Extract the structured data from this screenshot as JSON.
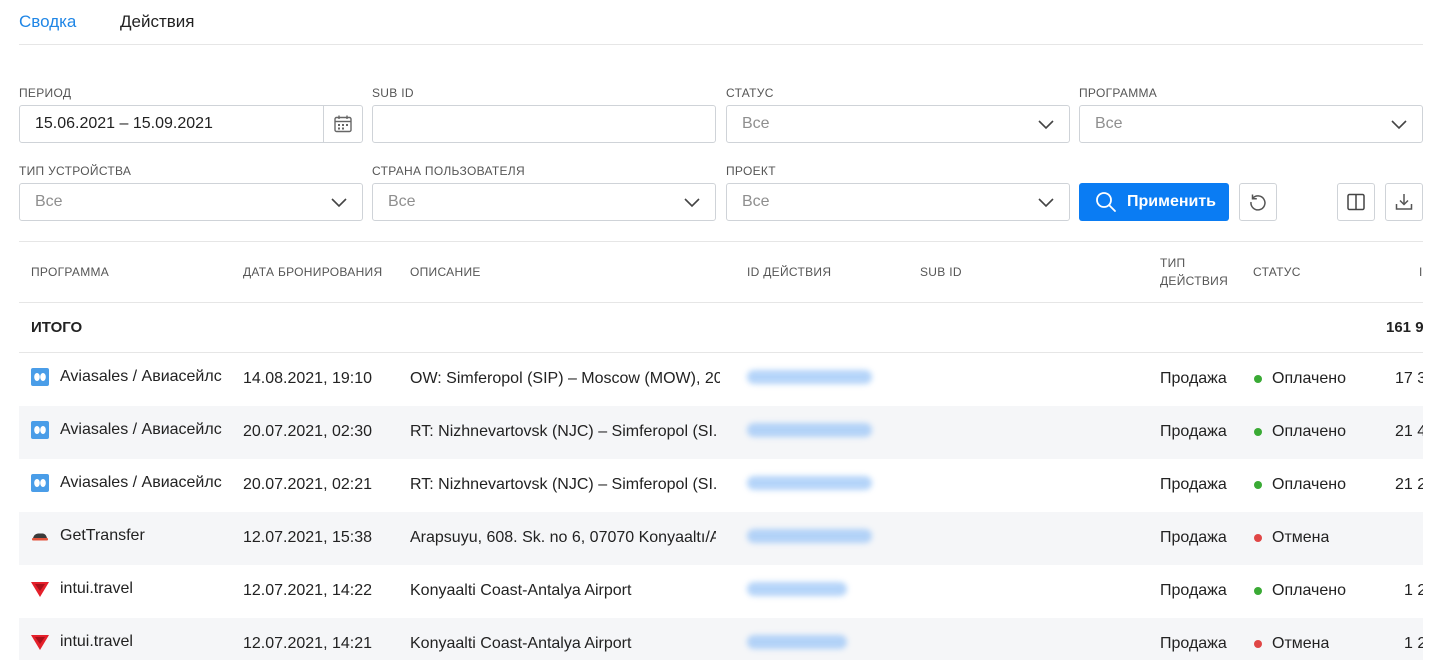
{
  "tabs": [
    {
      "label": "Сводка",
      "active": true
    },
    {
      "label": "Действия",
      "active": false
    }
  ],
  "filters": {
    "period": {
      "label": "ПЕРИОД",
      "value": "15.06.2021 – 15.09.2021"
    },
    "sub_id": {
      "label": "SUB ID",
      "value": ""
    },
    "status": {
      "label": "СТАТУС",
      "placeholder": "Все"
    },
    "program": {
      "label": "ПРОГРАММА",
      "placeholder": "Все"
    },
    "device_type": {
      "label": "ТИП УСТРОЙСТВА",
      "placeholder": "Все"
    },
    "user_country": {
      "label": "СТРАНА ПОЛЬЗОВАТЕЛЯ",
      "placeholder": "Все"
    },
    "project": {
      "label": "ПРОЕКТ",
      "placeholder": "Все"
    },
    "apply_label": "Применить"
  },
  "table": {
    "headers": {
      "program": "ПРОГРАММА",
      "booking_date": "ДАТА БРОНИРОВАНИЯ",
      "description": "ОПИСАНИЕ",
      "action_id": "ID ДЕЙСТВИЯ",
      "sub_id": "SUB ID",
      "action_type_1": "ТИП",
      "action_type_2": "ДЕЙСТВИЯ",
      "status": "СТАТУС",
      "last_partial": "I"
    },
    "total": {
      "label": "ИТОГО",
      "value": "161 9"
    },
    "rows": [
      {
        "icon": "aviasales-icon",
        "program": "Aviasales / Авиасейлс",
        "date": "14.08.2021, 19:10",
        "description": "OW: Simferopol (SIP) – Moscow (MOW), 20...",
        "type": "Продажа",
        "status": "Оплачено",
        "status_color": "#3aaa35",
        "amount": "17 3"
      },
      {
        "icon": "aviasales-icon",
        "program": "Aviasales / Авиасейлс",
        "date": "20.07.2021, 02:30",
        "description": "RT: Nizhnevartovsk (NJC) – Simferopol (SI...",
        "type": "Продажа",
        "status": "Оплачено",
        "status_color": "#3aaa35",
        "amount": "21 4"
      },
      {
        "icon": "aviasales-icon",
        "program": "Aviasales / Авиасейлс",
        "date": "20.07.2021, 02:21",
        "description": "RT: Nizhnevartovsk (NJC) – Simferopol (SI...",
        "type": "Продажа",
        "status": "Оплачено",
        "status_color": "#3aaa35",
        "amount": "21 2"
      },
      {
        "icon": "gettransfer-icon",
        "program": "GetTransfer",
        "date": "12.07.2021, 15:38",
        "description": "Arapsuyu, 608. Sk. no 6, 07070 Konyaaltı/A...",
        "type": "Продажа",
        "status": "Отмена",
        "status_color": "#e04646",
        "amount": ""
      },
      {
        "icon": "intui-icon",
        "program": "intui.travel",
        "date": "12.07.2021, 14:22",
        "description": "Konyaalti Coast-Antalya Airport",
        "type": "Продажа",
        "status": "Оплачено",
        "status_color": "#3aaa35",
        "amount": "1 2"
      },
      {
        "icon": "intui-icon",
        "program": "intui.travel",
        "date": "12.07.2021, 14:21",
        "description": "Konyaalti Coast-Antalya Airport",
        "type": "Продажа",
        "status": "Отмена",
        "status_color": "#e04646",
        "amount": "1 2"
      }
    ]
  }
}
